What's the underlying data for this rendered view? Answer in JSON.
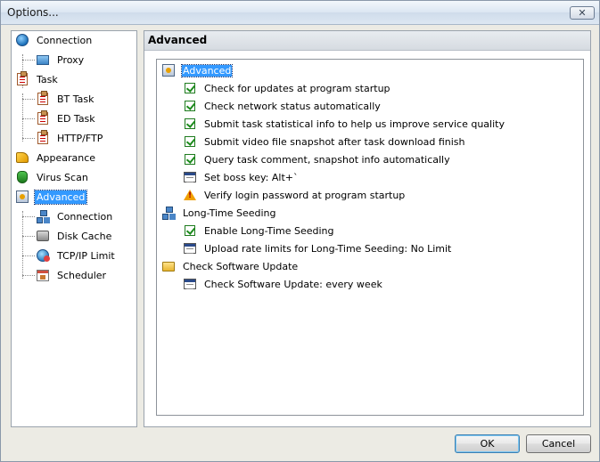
{
  "window": {
    "title": "Options...",
    "close_glyph": "✕"
  },
  "sidebar": {
    "items": [
      {
        "label": "Connection",
        "icon": "globe-icon"
      },
      {
        "label": "Proxy",
        "icon": "monitor-icon"
      },
      {
        "label": "Task",
        "icon": "clipboard-icon"
      },
      {
        "label": "BT Task",
        "icon": "clipboard-icon"
      },
      {
        "label": "ED Task",
        "icon": "clipboard-icon"
      },
      {
        "label": "HTTP/FTP",
        "icon": "clipboard-icon"
      },
      {
        "label": "Appearance",
        "icon": "paint-icon"
      },
      {
        "label": "Virus Scan",
        "icon": "shield-icon"
      },
      {
        "label": "Advanced",
        "icon": "advanced-icon",
        "selected": true
      },
      {
        "label": "Connection",
        "icon": "network-icon"
      },
      {
        "label": "Disk Cache",
        "icon": "disk-icon"
      },
      {
        "label": "TCP/IP Limit",
        "icon": "tcpip-icon"
      },
      {
        "label": "Scheduler",
        "icon": "scheduler-icon"
      }
    ]
  },
  "panel": {
    "header": "Advanced",
    "rows": [
      {
        "label": "Advanced",
        "type": "section",
        "icon": "advanced-icon"
      },
      {
        "label": "Check for updates at program startup",
        "type": "checkbox",
        "checked": true
      },
      {
        "label": "Check network status automatically",
        "type": "checkbox",
        "checked": true
      },
      {
        "label": "Submit task statistical info to help us improve service quality",
        "type": "checkbox",
        "checked": true
      },
      {
        "label": "Submit video file snapshot after task download finish",
        "type": "checkbox",
        "checked": true
      },
      {
        "label": "Query task comment, snapshot info automatically",
        "type": "checkbox",
        "checked": true
      },
      {
        "label": "Set boss key: Alt+`",
        "type": "edit",
        "icon": "edit-icon"
      },
      {
        "label": "Verify login password at program startup",
        "type": "warning",
        "icon": "warning-icon"
      },
      {
        "label": "Long-Time Seeding",
        "type": "section",
        "icon": "network-icon"
      },
      {
        "label": "Enable Long-Time Seeding",
        "type": "checkbox",
        "checked": true
      },
      {
        "label": "Upload rate limits for Long-Time Seeding: No Limit",
        "type": "edit",
        "icon": "edit-icon"
      },
      {
        "label": "Check Software Update",
        "type": "section",
        "icon": "folder-icon"
      },
      {
        "label": "Check Software Update: every week",
        "type": "edit",
        "icon": "edit-icon"
      }
    ]
  },
  "footer": {
    "ok_label": "OK",
    "cancel_label": "Cancel"
  }
}
